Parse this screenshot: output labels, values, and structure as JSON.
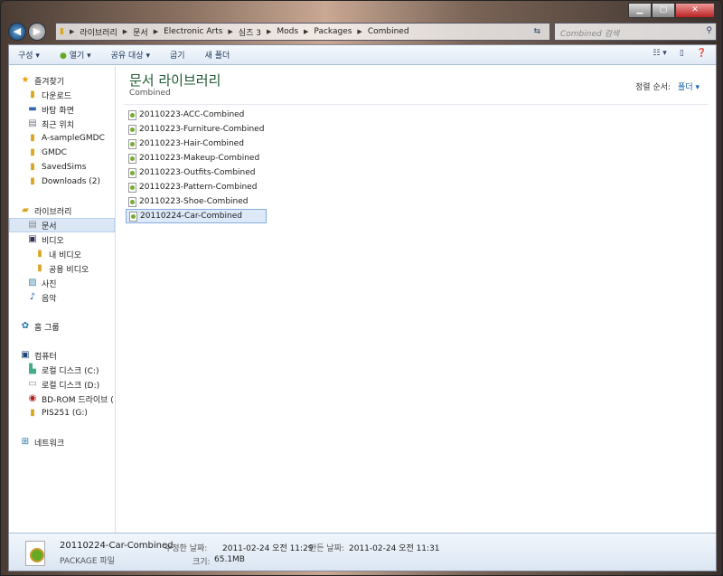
{
  "address": {
    "crumbs": [
      "라이브러리",
      "문서",
      "Electronic Arts",
      "심즈 3",
      "Mods",
      "Packages",
      "Combined"
    ],
    "search_placeholder": "Combined 검색"
  },
  "toolbar": {
    "organize": "구성 ▾",
    "open": "열기 ▾",
    "share": "공유 대상 ▾",
    "burn": "굽기",
    "new_folder": "새 폴더"
  },
  "sidebar": {
    "favorites": {
      "label": "즐겨찾기",
      "items": [
        "다운로드",
        "바탕 화면",
        "최근 위치",
        "A-sampleGMDC",
        "GMDC",
        "SavedSims",
        "Downloads (2)"
      ]
    },
    "libraries": {
      "label": "라이브러리",
      "items": [
        "문서",
        "비디오",
        "내 비디오",
        "공용 비디오",
        "사진",
        "음악"
      ]
    },
    "homegroup": "홈 그룹",
    "computer": {
      "label": "컴퓨터",
      "items": [
        "로컬 디스크 (C:)",
        "로컬 디스크 (D:)",
        "BD-ROM 드라이브 (",
        "PIS251 (G:)"
      ]
    },
    "network": "네트워크"
  },
  "main": {
    "title": "문서 라이브러리",
    "subtitle": "Combined",
    "sort_label": "정렬 순서:",
    "sort_value": "폴더 ▾",
    "files": [
      "20110223-ACC-Combined",
      "20110223-Furniture-Combined",
      "20110223-Hair-Combined",
      "20110223-Makeup-Combined",
      "20110223-Outfits-Combined",
      "20110223-Pattern-Combined",
      "20110223-Shoe-Combined",
      "20110224-Car-Combined"
    ]
  },
  "status": {
    "name": "20110224-Car-Combined",
    "type": "PACKAGE 파일",
    "modified_label": "수정한 날짜:",
    "modified": "2011-02-24 오전 11:29",
    "created_label": "만든 날짜:",
    "created": "2011-02-24 오전 11:31",
    "size_label": "크기:",
    "size": "65.1MB"
  }
}
